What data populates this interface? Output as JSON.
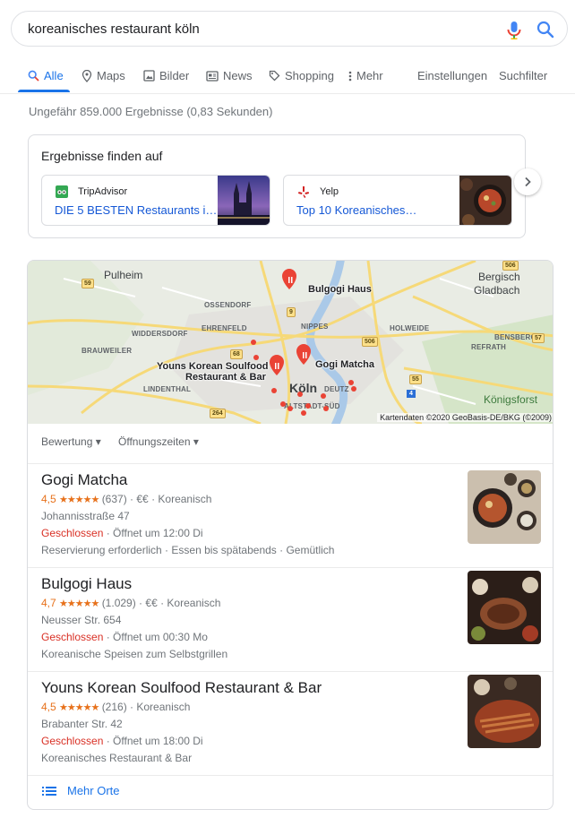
{
  "search": {
    "query": "koreanisches restaurant köln"
  },
  "tabs": [
    {
      "label": "Alle",
      "icon": "search-icon",
      "active": true
    },
    {
      "label": "Maps",
      "icon": "map-pin-icon"
    },
    {
      "label": "Bilder",
      "icon": "image-icon"
    },
    {
      "label": "News",
      "icon": "news-icon"
    },
    {
      "label": "Shopping",
      "icon": "tag-icon"
    },
    {
      "label": "Mehr",
      "icon": "more-vertical-icon"
    }
  ],
  "tools": {
    "settings": "Einstellungen",
    "filter": "Suchfilter"
  },
  "stats": "Ungefähr 859.000 Ergebnisse (0,83 Sekunden)",
  "find_on": {
    "title": "Ergebnisse finden auf",
    "sources": [
      {
        "name": "TripAdvisor",
        "link": "DIE 5 BESTEN Restaurants i…"
      },
      {
        "name": "Yelp",
        "link": "Top 10 Koreanisches…"
      }
    ]
  },
  "map": {
    "labels": {
      "pulheim": "Pulheim",
      "bergisch": "Bergisch",
      "gladbach": "Gladbach",
      "ossendorf": "OSSENDORF",
      "nippes": "NIPPES",
      "widdersdorf": "WIDDERSDORF",
      "ehrenfeld": "EHRENFELD",
      "holweide": "HOLWEIDE",
      "bensberg": "BENSBERG",
      "brauweiler": "BRAUWEILER",
      "refrath": "REFRATH",
      "lindenthal": "LINDENTHAL",
      "deutz": "DEUTZ",
      "koeln": "Köln",
      "altstadt": "ALTSTADT-SÜD",
      "koenigsforst": "Königsforst"
    },
    "roads": [
      "59",
      "506",
      "9",
      "68",
      "57",
      "506",
      "55",
      "4",
      "264"
    ],
    "places": {
      "bulgogi": "Bulgogi Haus",
      "gogi": "Gogi Matcha",
      "youns_line1": "Youns Korean Soulfood",
      "youns_line2": "Restaurant & Bar"
    },
    "copyright": "Kartendaten ©2020 GeoBasis-DE/BKG (©2009)"
  },
  "filters": {
    "rating": "Bewertung",
    "hours": "Öffnungszeiten"
  },
  "listings": [
    {
      "name": "Gogi Matcha",
      "rating": "4,5",
      "stars": 4.5,
      "reviews": "(637)",
      "price": "€€",
      "category": "Koreanisch",
      "address": "Johannisstraße 47",
      "status": "Geschlossen",
      "opens": "Öffnet um 12:00 Di",
      "extra": "Reservierung erforderlich · Essen bis spätabends · Gemütlich"
    },
    {
      "name": "Bulgogi Haus",
      "rating": "4,7",
      "stars": 4.7,
      "reviews": "(1.029)",
      "price": "€€",
      "category": "Koreanisch",
      "address": "Neusser Str. 654",
      "status": "Geschlossen",
      "opens": "Öffnet um 00:30 Mo",
      "extra": "Koreanische Speisen zum Selbstgrillen"
    },
    {
      "name": "Youns Korean Soulfood Restaurant & Bar",
      "rating": "4,5",
      "stars": 4.5,
      "reviews": "(216)",
      "price": "",
      "category": "Koreanisch",
      "address": "Brabanter Str. 42",
      "status": "Geschlossen",
      "opens": "Öffnet um 18:00 Di",
      "extra": "Koreanisches Restaurant & Bar"
    }
  ],
  "more_places": "Mehr Orte",
  "colors": {
    "accent": "#1a73e8",
    "rating": "#e7711b",
    "closed": "#d93025",
    "pin": "#ea4335"
  }
}
